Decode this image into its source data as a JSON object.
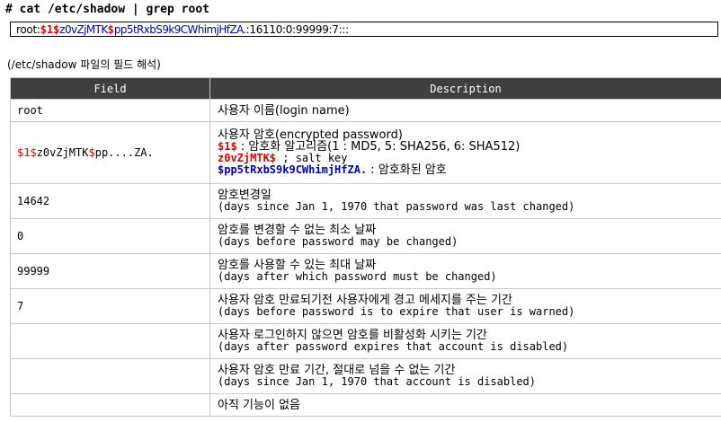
{
  "command": "# cat /etc/shadow | grep root",
  "shadow_line": {
    "user": "root:",
    "dollar1": "$1$",
    "salt": "z0vZjMTK",
    "dollar2": "$",
    "hash": "pp5tRxbS9k9CWhimjHfZA.",
    "rest": ":16110:0:99999:7:::"
  },
  "caption": "(/etc/shadow 파일의 필드 해석)",
  "table": {
    "headers": [
      "Field",
      "Description"
    ],
    "rows": [
      {
        "field": "root",
        "lines": [
          "사용자 이름(login name)"
        ]
      },
      {
        "field_parts": [
          "$1$",
          "z0vZjMTK",
          "$",
          "pp....ZA."
        ],
        "lines": [
          "사용자 암호(encrypted password)"
        ],
        "detail": [
          {
            "code": "$1$",
            "text": "  : 암호화 알고리즘(1 : MD5, 5: SHA256, 6: SHA512)"
          },
          {
            "code": "z0vZjMTK$",
            "text": "  ; salt key"
          },
          {
            "code": "$pp5tRxbS9k9CWhimjHfZA.",
            "text": "  : 암호화된 암호"
          }
        ]
      },
      {
        "field": "14642",
        "lines": [
          "암호변경일",
          "(days since Jan 1, 1970 that password was last changed)"
        ]
      },
      {
        "field": "0",
        "lines": [
          "암호를 변경할 수 없는 최소 날짜",
          "(days before password may be changed)"
        ]
      },
      {
        "field": "99999",
        "lines": [
          "암호를 사용할 수 있는 최대 날짜",
          "(days after which password must be changed)"
        ]
      },
      {
        "field": "7",
        "lines": [
          "사용자 암호 만료되기전 사용자에게 경고 메세지를 주는 기간",
          "(days before password is to expire that user is warned)"
        ]
      },
      {
        "field": "",
        "lines": [
          "사용자 로그인하지 않으면 암호를 비활성화 시키는 기간",
          "(days after password expires that account is disabled)"
        ]
      },
      {
        "field": "",
        "lines": [
          "사용자 암호 만료 기간, 절대로 넘을 수 없는 기간",
          "(days since Jan 1, 1970 that account is disabled)"
        ]
      },
      {
        "field": "",
        "lines": [
          "아직 기능이 없음"
        ]
      }
    ]
  }
}
